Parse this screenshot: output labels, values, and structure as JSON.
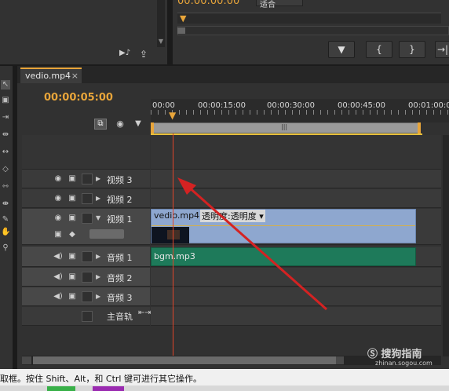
{
  "source_monitor": {
    "timecode": "00:00:00:00",
    "fit_label": "适合"
  },
  "program_buttons": [
    "▼",
    "{",
    "}",
    "→|"
  ],
  "sequence_tab": {
    "label": "vedio.mp4",
    "close": "×"
  },
  "timeline": {
    "current_time": "00:00:05:00",
    "ruler_ticks": [
      "00:00",
      "00:00:15:00",
      "00:00:30:00",
      "00:00:45:00",
      "00:01:00:0"
    ]
  },
  "video_tracks": [
    {
      "name": "视频 3"
    },
    {
      "name": "视频 2"
    },
    {
      "name": "视频 1"
    }
  ],
  "audio_tracks": [
    {
      "name": "音频 1"
    },
    {
      "name": "音频 2"
    },
    {
      "name": "音频 3"
    },
    {
      "name": "主音轨"
    }
  ],
  "clips": {
    "video": {
      "name": "vedio.mp4",
      "menu": "透明度:透明度"
    },
    "audio": {
      "name": "bgm.mp3"
    }
  },
  "status_bar": {
    "text": "取框。按住 Shift、Alt，和 Ctrl 键可进行其它操作。"
  },
  "watermark": {
    "brand": "搜狗指南",
    "url": "zhinan.sogou.com"
  },
  "colors": {
    "timecode": "#e8a53a",
    "playhead": "#e0452a",
    "video_clip": "#8ea7cf",
    "audio_clip": "#1e7a5a",
    "arrow": "#d42222"
  }
}
